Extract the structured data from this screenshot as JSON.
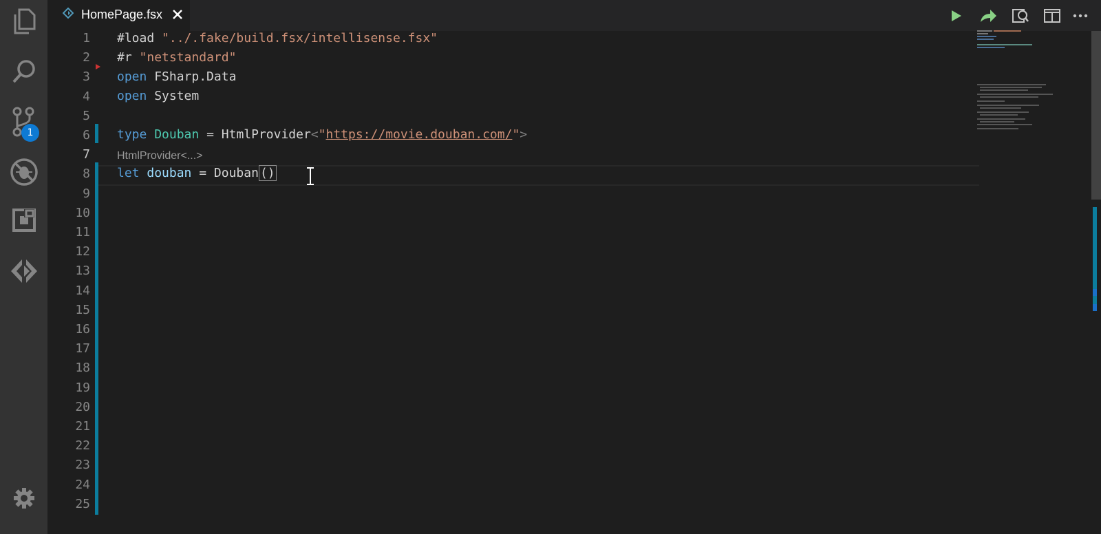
{
  "activity_bar": {
    "icons": [
      "explorer-icon",
      "search-icon",
      "source-control-icon",
      "debug-icon",
      "extensions-icon",
      "fsharp-icon"
    ],
    "source_control_badge": "1",
    "settings_icon": "gear-icon"
  },
  "tab": {
    "label": "HomePage.fsx",
    "icon": "fsharp-file-icon",
    "close_icon": "close-icon"
  },
  "toolbar": {
    "icons": [
      "run-icon",
      "send-icon",
      "open-preview-icon",
      "split-editor-icon",
      "more-icon"
    ]
  },
  "editor": {
    "line_numbers": [
      "1",
      "2",
      "3",
      "4",
      "5",
      "6",
      "7",
      "8",
      "9",
      "10",
      "11",
      "12",
      "13",
      "14",
      "15",
      "16",
      "17",
      "18",
      "19",
      "20",
      "21",
      "22",
      "23",
      "24",
      "25"
    ],
    "active_line": "7",
    "lines": {
      "l1_directive": "#load",
      "l1_string": "\"../.fake/build.fsx/intellisense.fsx\"",
      "l2_directive": "#r",
      "l2_string": "\"netstandard\"",
      "l3_kw": "open",
      "l3_ns": "FSharp.Data",
      "l4_kw": "open",
      "l4_ns": "System",
      "l6_kw": "type",
      "l6_name": "Douban",
      "l6_eq": "=",
      "l6_provider": "HtmlProvider",
      "l6_lt": "<",
      "l6_quote_open": "\"",
      "l6_url": "https://movie.douban.com/",
      "l6_quote_close": "\"",
      "l6_gt": ">",
      "codelens": "HtmlProvider<...>",
      "l7_kw": "let",
      "l7_name": "douban",
      "l7_eq": "=",
      "l7_ctor": "Douban",
      "l7_parens": "()"
    }
  },
  "colors": {
    "background": "#1e1e1e",
    "activity_bar": "#333333",
    "keyword": "#569cd6",
    "string": "#ce9178",
    "type": "#4ec9b0",
    "variable": "#9cdcfe",
    "badge": "#0e7ad3",
    "run_green": "#89d185",
    "diff_bar": "#0c7d9d"
  }
}
